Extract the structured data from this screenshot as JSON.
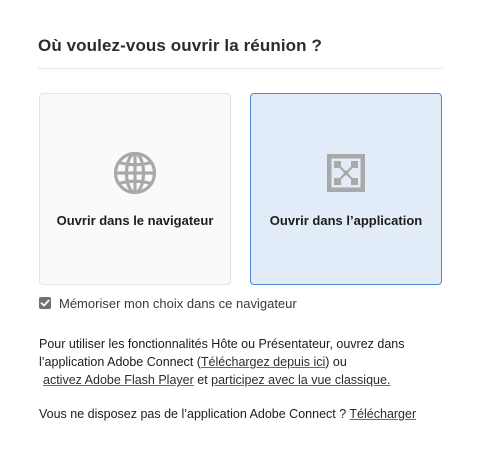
{
  "dialog": {
    "title": "Où voulez-vous ouvrir la réunion ?"
  },
  "options": {
    "browser": {
      "label": "Ouvrir dans le navigateur",
      "icon": "globe-icon"
    },
    "app": {
      "label": "Ouvrir dans l’application",
      "icon": "adobe-connect-app-icon",
      "selected": true
    }
  },
  "remember": {
    "label": "Mémoriser mon choix dans ce navigateur",
    "checked": true
  },
  "info": {
    "line1": "Pour utiliser les fonctionnalités Hôte ou Présentateur, ouvrez dans",
    "line2_prefix": "l’application Adobe Connect (",
    "line2_link": "Téléchargez depuis ici",
    "line2_suffix": ") ou",
    "line3_link1": "activez Adobe Flash Player",
    "line3_mid": " et ",
    "line3_link2": "participez avec la vue classique."
  },
  "download": {
    "prefix": "Vous ne disposez pas de l’application Adobe Connect ? ",
    "link": "Télécharger"
  },
  "colors": {
    "selected_border": "#4a8bd4",
    "selected_bg": "#e2ecf8",
    "icon_gray": "#a9a9a9"
  }
}
